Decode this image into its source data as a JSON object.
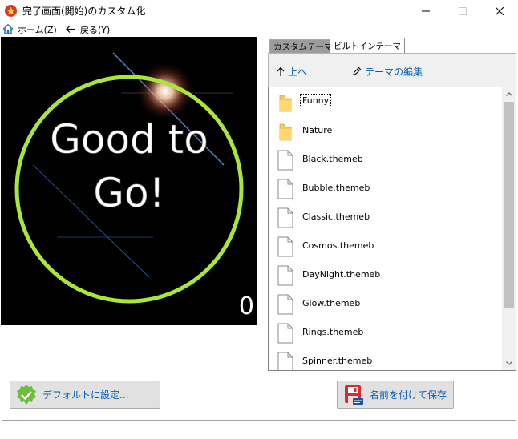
{
  "window": {
    "title": "完了画面(開始)のカスタム化"
  },
  "menu": {
    "home_label": "ホーム(Z)",
    "back_label": "戻る(Y)"
  },
  "preview": {
    "message_line1": "Good to",
    "message_line2": "Go!",
    "counter": "0",
    "ring_color": "#a8e63c"
  },
  "tabs": [
    {
      "label": "カスタムテーマ",
      "selected": false
    },
    {
      "label": "ビルトインテーマ",
      "selected": true
    }
  ],
  "toolbar": {
    "up_label": "上へ",
    "edit_label": "テーマの編集"
  },
  "files": [
    {
      "name": "Funny",
      "type": "folder",
      "selected": true
    },
    {
      "name": "Nature",
      "type": "folder",
      "selected": false
    },
    {
      "name": "Black.themeb",
      "type": "file",
      "selected": false
    },
    {
      "name": "Bubble.themeb",
      "type": "file",
      "selected": false
    },
    {
      "name": "Classic.themeb",
      "type": "file",
      "selected": false
    },
    {
      "name": "Cosmos.themeb",
      "type": "file",
      "selected": false
    },
    {
      "name": "DayNight.themeb",
      "type": "file",
      "selected": false
    },
    {
      "name": "Glow.themeb",
      "type": "file",
      "selected": false
    },
    {
      "name": "Rings.themeb",
      "type": "file",
      "selected": false
    },
    {
      "name": "Spinner.themeb",
      "type": "file",
      "selected": false
    }
  ],
  "buttons": {
    "default_label": "デフォルトに設定...",
    "saveas_label": "名前を付けて保存"
  },
  "colors": {
    "link_blue": "#0060b8",
    "folder_yellow": "#f5c95a"
  }
}
